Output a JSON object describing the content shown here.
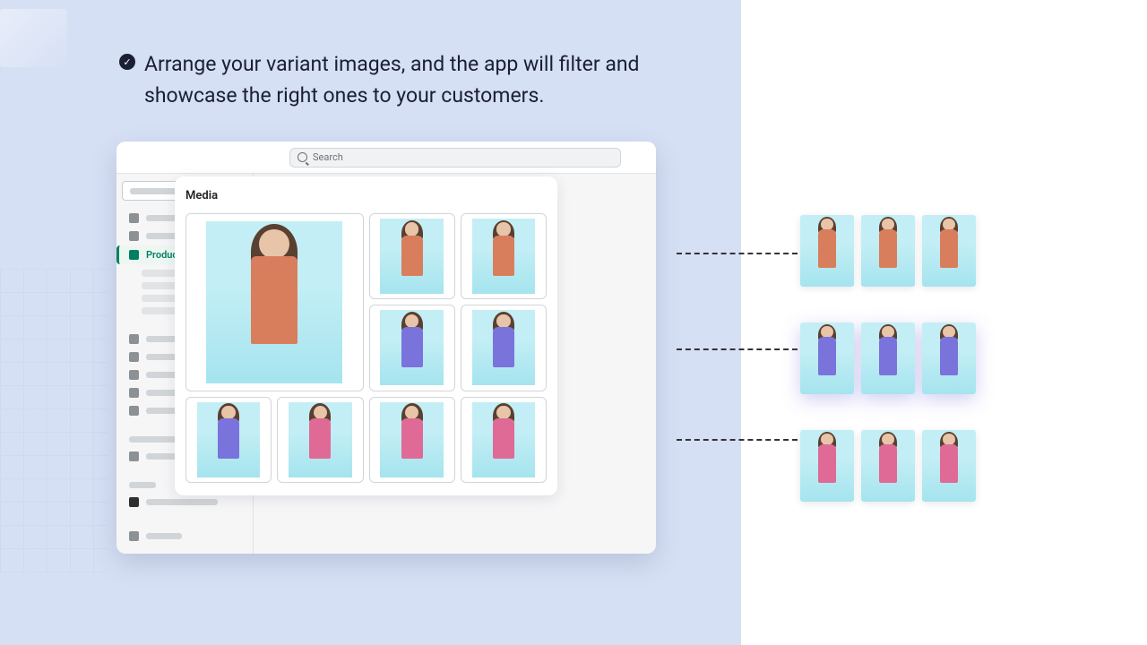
{
  "headline": "Arrange your variant images, and the app will filter and showcase the right ones to your customers.",
  "search": {
    "placeholder": "Search"
  },
  "sidebar": {
    "active_label": "Products"
  },
  "media": {
    "title": "Media",
    "variants": {
      "orange": "orange",
      "purple": "purple",
      "pink": "pink"
    }
  },
  "right_groups": [
    {
      "color": "orange",
      "count": 3,
      "glow": false
    },
    {
      "color": "purple",
      "count": 3,
      "glow": true
    },
    {
      "color": "pink",
      "count": 3,
      "glow": false
    }
  ]
}
